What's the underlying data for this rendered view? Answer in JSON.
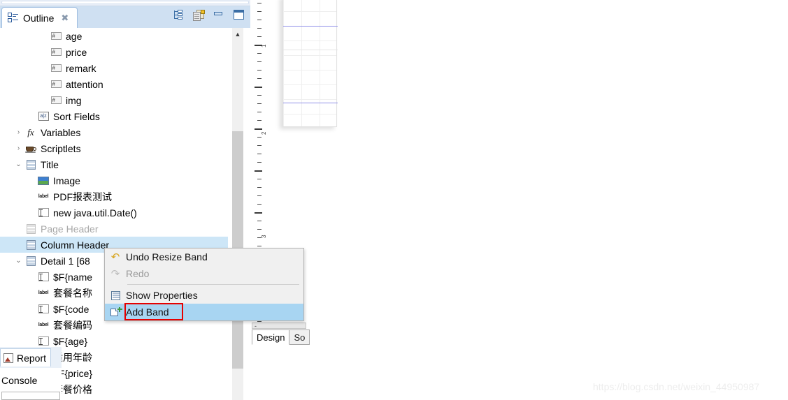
{
  "window": {
    "watermark": "https://blog.csdn.net/weixin_44950987"
  },
  "outline": {
    "tab_label": "Outline",
    "close_glyph": "✖",
    "toolbar": [
      {
        "name": "hierarchy-icon",
        "tooltip": "Link with Editor"
      },
      {
        "name": "layered-pages-icon",
        "tooltip": "Show Report Elements"
      },
      {
        "name": "minimize-icon",
        "tooltip": "Minimize"
      },
      {
        "name": "maximize-icon",
        "tooltip": "Maximize"
      }
    ],
    "tree": [
      {
        "label": "age",
        "icon": "field-icon",
        "indent": 3,
        "twisty": "",
        "state": "normal"
      },
      {
        "label": "price",
        "icon": "field-icon",
        "indent": 3,
        "twisty": "",
        "state": "normal"
      },
      {
        "label": "remark",
        "icon": "field-icon",
        "indent": 3,
        "twisty": "",
        "state": "normal"
      },
      {
        "label": "attention",
        "icon": "field-icon",
        "indent": 3,
        "twisty": "",
        "state": "normal"
      },
      {
        "label": "img",
        "icon": "field-icon",
        "indent": 3,
        "twisty": "",
        "state": "normal"
      },
      {
        "label": "Sort Fields",
        "icon": "sort-fields-icon",
        "indent": 2,
        "twisty": "",
        "state": "normal"
      },
      {
        "label": "Variables",
        "icon": "fx-icon",
        "indent": 1,
        "twisty": "›",
        "state": "normal"
      },
      {
        "label": "Scriptlets",
        "icon": "coffee-cup-icon",
        "indent": 1,
        "twisty": "›",
        "state": "normal"
      },
      {
        "label": "Title",
        "icon": "band-icon",
        "indent": 1,
        "twisty": "⌄",
        "state": "normal"
      },
      {
        "label": "Image",
        "icon": "image-icon",
        "indent": 2,
        "twisty": "",
        "state": "normal"
      },
      {
        "label": "PDF报表测试",
        "icon": "static-text-icon",
        "indent": 2,
        "twisty": "",
        "state": "normal"
      },
      {
        "label": "new java.util.Date()",
        "icon": "text-field-icon",
        "indent": 2,
        "twisty": "",
        "state": "normal"
      },
      {
        "label": "Page Header",
        "icon": "band-icon",
        "indent": 1,
        "twisty": "",
        "state": "disabled"
      },
      {
        "label": "Column Header",
        "icon": "band-icon",
        "indent": 1,
        "twisty": "",
        "state": "selected"
      },
      {
        "label": "Detail 1 [68",
        "icon": "band-icon",
        "indent": 1,
        "twisty": "⌄",
        "state": "normal"
      },
      {
        "label": "$F{name",
        "icon": "text-field-icon",
        "indent": 2,
        "twisty": "",
        "state": "normal"
      },
      {
        "label": "套餐名称",
        "icon": "static-text-icon",
        "indent": 2,
        "twisty": "",
        "state": "normal"
      },
      {
        "label": "$F{code",
        "icon": "text-field-icon",
        "indent": 2,
        "twisty": "",
        "state": "normal"
      },
      {
        "label": "套餐编码",
        "icon": "static-text-icon",
        "indent": 2,
        "twisty": "",
        "state": "normal"
      },
      {
        "label": "$F{age}",
        "icon": "text-field-icon",
        "indent": 2,
        "twisty": "",
        "state": "normal"
      },
      {
        "label": "适用年龄",
        "icon": "static-text-icon",
        "indent": 2,
        "twisty": "",
        "state": "normal"
      },
      {
        "label": "$F{price}",
        "icon": "text-field-icon",
        "indent": 2,
        "twisty": "",
        "state": "normal"
      },
      {
        "label": "套餐价格",
        "icon": "static-text-icon",
        "indent": 2,
        "twisty": "",
        "state": "normal"
      }
    ]
  },
  "context_menu": {
    "items": [
      {
        "label": "Undo Resize Band",
        "icon": "undo-icon",
        "state": "enabled"
      },
      {
        "label": "Redo",
        "icon": "redo-icon",
        "state": "disabled"
      },
      {
        "label": "Show Properties",
        "icon": "properties-icon",
        "state": "enabled"
      },
      {
        "label": "Add Band",
        "icon": "add-band-icon",
        "state": "highlighted"
      }
    ],
    "highlight_color": "#a8d5f2",
    "annotation_color": "#e60000"
  },
  "designer": {
    "editor_tabs": [
      {
        "label": "Design",
        "active": true
      },
      {
        "label": "So",
        "active": false
      }
    ],
    "ruler_labels": [
      "1",
      "2",
      "3"
    ]
  },
  "bottom_panel": {
    "tab_label": "Report",
    "console_label": "Console"
  }
}
